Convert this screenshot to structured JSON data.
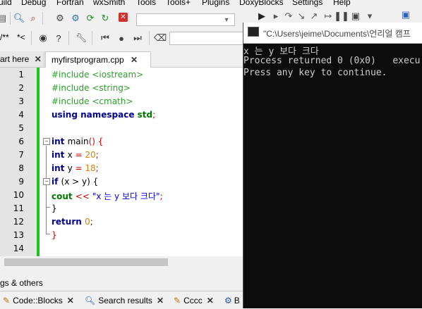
{
  "menu": [
    "uild",
    "Debug",
    "Fortran",
    "wxSmith",
    "Tools",
    "Tools+",
    "Plugins",
    "DoxyBlocks",
    "Settings",
    "Help"
  ],
  "toolbar": {
    "comment_label": "/**",
    "line_comment_label": "*<"
  },
  "tabs": {
    "start_here": "art here",
    "file": "myfirstprogram.cpp"
  },
  "editor": {
    "line_numbers": [
      "1",
      "2",
      "3",
      "4",
      "5",
      "6",
      "7",
      "8",
      "9",
      "10",
      "11",
      "12",
      "13",
      "14"
    ],
    "lines": [
      {
        "parts": [
          {
            "t": "#include <iostream>",
            "c": "pp"
          }
        ]
      },
      {
        "parts": [
          {
            "t": "#include <string>",
            "c": "pp"
          }
        ]
      },
      {
        "parts": [
          {
            "t": "#include <cmath>",
            "c": "pp"
          }
        ]
      },
      {
        "parts": [
          {
            "t": "using namespace ",
            "c": "kw"
          },
          {
            "t": "std",
            "c": "kwg"
          },
          {
            "t": ";",
            "c": "op"
          }
        ]
      },
      {
        "parts": []
      },
      {
        "parts": [
          {
            "t": "int ",
            "c": "kw"
          },
          {
            "t": "main",
            "c": ""
          },
          {
            "t": "() {",
            "c": "op"
          }
        ]
      },
      {
        "parts": [
          {
            "t": "int ",
            "c": "kw"
          },
          {
            "t": "x ",
            "c": ""
          },
          {
            "t": "= ",
            "c": "op"
          },
          {
            "t": "20",
            "c": "num"
          },
          {
            "t": ";",
            "c": "op"
          }
        ]
      },
      {
        "parts": [
          {
            "t": "int ",
            "c": "kw"
          },
          {
            "t": "y ",
            "c": ""
          },
          {
            "t": "= ",
            "c": "op"
          },
          {
            "t": "18",
            "c": "num"
          },
          {
            "t": ";",
            "c": "op"
          }
        ]
      },
      {
        "parts": [
          {
            "t": "if ",
            "c": "kw"
          },
          {
            "t": "(x > y) {",
            "c": ""
          }
        ]
      },
      {
        "parts": [
          {
            "t": "cout ",
            "c": "kwg"
          },
          {
            "t": "<< ",
            "c": "op"
          },
          {
            "t": "\"x 는 y 보다 크다\"",
            "c": "str"
          },
          {
            "t": ";",
            "c": "op"
          }
        ]
      },
      {
        "parts": [
          {
            "t": "}",
            "c": ""
          }
        ]
      },
      {
        "parts": [
          {
            "t": "return ",
            "c": "kw"
          },
          {
            "t": "0",
            "c": "num"
          },
          {
            "t": ";",
            "c": "op"
          }
        ]
      },
      {
        "parts": [
          {
            "t": "}",
            "c": "op"
          }
        ]
      },
      {
        "parts": []
      }
    ]
  },
  "logs": {
    "title": "gs & others",
    "tabs": [
      "Code::Blocks",
      "Search results",
      "Cccc",
      "B"
    ]
  },
  "console": {
    "title": "\"C:\\Users\\jeime\\Documents\\언리얼 캠프",
    "lines": [
      "x 는 y 보다 크다",
      "Process returned 0 (0x0)   execu",
      "Press any key to continue."
    ]
  },
  "colors": {
    "changebar": "#1ec41e",
    "console_bg": "#0c0c0c",
    "console_fg": "#cccccc"
  }
}
